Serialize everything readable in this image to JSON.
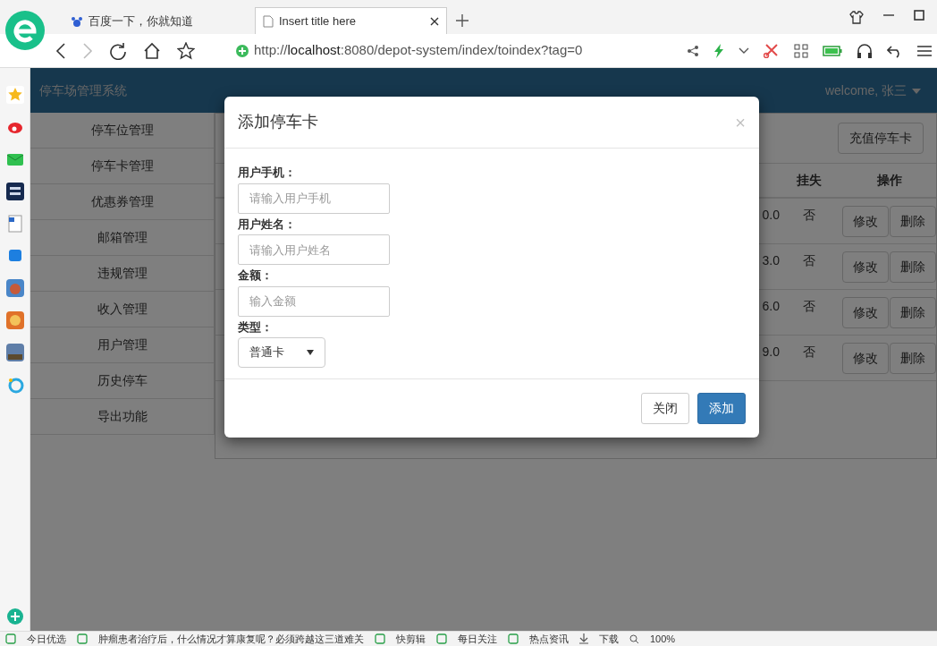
{
  "browser": {
    "tabs": [
      {
        "title": "百度一下，你就知道",
        "selected": false
      },
      {
        "title": "Insert title here",
        "selected": true
      }
    ],
    "address": "http://**localhost**:8080/depot-system/index/toindex?tag=0"
  },
  "app": {
    "brand": "停车场管理系统",
    "user_menu": "welcome, 张三",
    "menu": [
      "停车位管理",
      "停车卡管理",
      "优惠券管理",
      "邮箱管理",
      "违规管理",
      "收入管理",
      "用户管理",
      "历史停车",
      "导出功能"
    ],
    "toolbar_button": "充值停车卡",
    "table": {
      "columns": [
        "挂失",
        "操作"
      ],
      "rows": [
        {
          "column_1": "0.0",
          "lost": "否",
          "actions": [
            "修改",
            "删除"
          ]
        },
        {
          "column_1": "3.0",
          "lost": "否",
          "actions": [
            "修改",
            "删除"
          ]
        },
        {
          "column_1": "6.0",
          "lost": "否",
          "actions": [
            "修改",
            "删除"
          ]
        },
        {
          "column_1": "9.0",
          "lost": "否",
          "actions": [
            "修改",
            "删除"
          ]
        }
      ]
    }
  },
  "modal": {
    "title": "添加停车卡",
    "close": "×",
    "fields": [
      {
        "label": "用户手机：",
        "kind": "text",
        "placeholder": "请输入用户手机"
      },
      {
        "label": "用户姓名：",
        "kind": "text",
        "placeholder": "请输入用户姓名"
      },
      {
        "label": "金额：",
        "kind": "text",
        "placeholder": "输入金额"
      },
      {
        "label": "类型：",
        "kind": "select",
        "value": "普通卡"
      }
    ],
    "buttons": [
      {
        "label": "关闭",
        "kind": "secondary"
      },
      {
        "label": "添加",
        "kind": "primary"
      }
    ]
  },
  "status_bar": {
    "items": [
      "今日优选",
      "肿瘤患者治疗后，什么情况才算康复呢？必须跨越这三道难关",
      "快剪辑",
      "每日关注",
      "热点资讯",
      "下载",
      "100%"
    ]
  }
}
